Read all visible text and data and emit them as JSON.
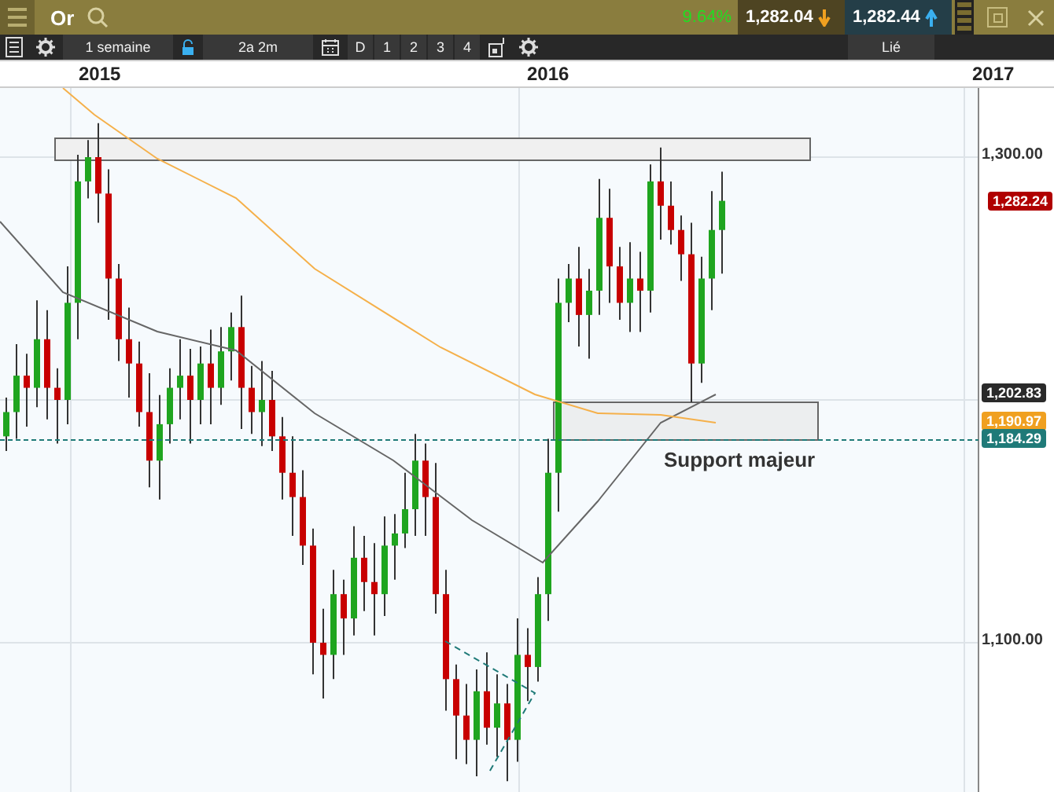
{
  "header": {
    "instrument": "Or",
    "change": "9.64%",
    "bid": "1,282.04",
    "ask": "1,282.44"
  },
  "toolbar": {
    "period": "1 semaine",
    "range": "2a 2m",
    "buttons": [
      "D",
      "1",
      "2",
      "3",
      "4"
    ],
    "link": "Lié"
  },
  "chart": {
    "years": [
      "2015",
      "2016",
      "2017"
    ],
    "price_ticks": [
      "1,300.00",
      "1,100.00"
    ],
    "tags": [
      {
        "text": "1,282.24",
        "color": "#b00000"
      },
      {
        "text": "1,202.83",
        "color": "#2a2a2a"
      },
      {
        "text": "1,190.97",
        "color": "#f0a020"
      },
      {
        "text": "1,184.29",
        "color": "#1f7a78"
      }
    ],
    "annotation": "Support majeur"
  }
}
